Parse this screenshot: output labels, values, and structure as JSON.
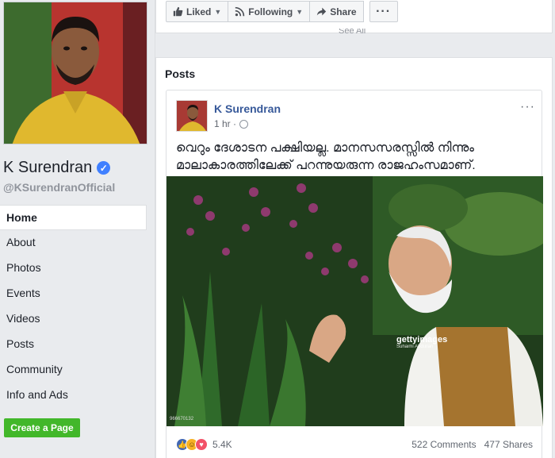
{
  "page": {
    "name": "K Surendran",
    "handle": "@KSurendranOfficial"
  },
  "nav": {
    "items": [
      "Home",
      "About",
      "Photos",
      "Events",
      "Videos",
      "Posts",
      "Community",
      "Info and Ads"
    ]
  },
  "create_page_label": "Create a Page",
  "actions": {
    "liked_label": "Liked",
    "following_label": "Following",
    "share_label": "Share",
    "more_label": "···"
  },
  "see_all": "See All",
  "posts_section": {
    "title": "Posts"
  },
  "post": {
    "author": "K Surendran",
    "time": "1 hr ·",
    "text": "വെറും ദേശാടന പക്ഷിയല്ല. മാനസസരസ്സിൽ നിന്നും മാലാകാരത്തിലേക്ക് പറന്നുയരുന്ന രാജഹംസമാണ്.",
    "menu": "···",
    "watermark": "gettyimages",
    "watermark_credit": "Suhaimi Abdullah",
    "image_code": "966670132",
    "reaction_count": "5.4K",
    "comments": "522 Comments",
    "shares": "477 Shares"
  },
  "colors": {
    "link_blue": "#365899",
    "create_green": "#42b72a",
    "background": "#e9ebee"
  },
  "icons": [
    "verified-badge-icon",
    "thumbs-up-icon",
    "rss-icon",
    "share-arrow-icon",
    "globe-icon",
    "like-reaction-icon",
    "haha-reaction-icon",
    "love-reaction-icon"
  ]
}
